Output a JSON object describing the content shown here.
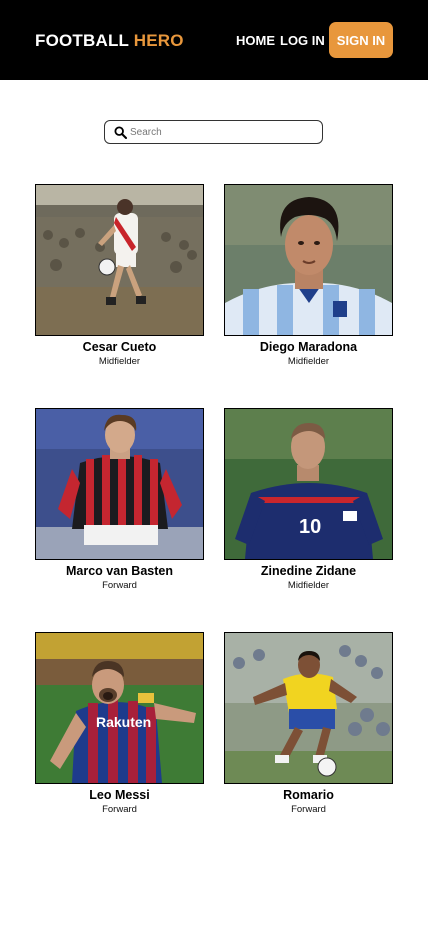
{
  "header": {
    "brand_part1": "FOOTBALL",
    "brand_part2": "HERO",
    "nav_home": "HOME",
    "nav_login": "LOG IN",
    "signin_label": "SIGN IN",
    "accent_color": "#e8973c",
    "background_color": "#000000"
  },
  "search": {
    "placeholder": "Search",
    "value": "",
    "icon": "search-icon"
  },
  "players": [
    {
      "name": "Cesar Cueto",
      "position": "Midfielder"
    },
    {
      "name": "Diego Maradona",
      "position": "Midfielder"
    },
    {
      "name": "Marco van Basten",
      "position": "Forward"
    },
    {
      "name": "Zinedine Zidane",
      "position": "Midfielder"
    },
    {
      "name": "Leo Messi",
      "position": "Forward"
    },
    {
      "name": "Romario",
      "position": "Forward"
    }
  ]
}
